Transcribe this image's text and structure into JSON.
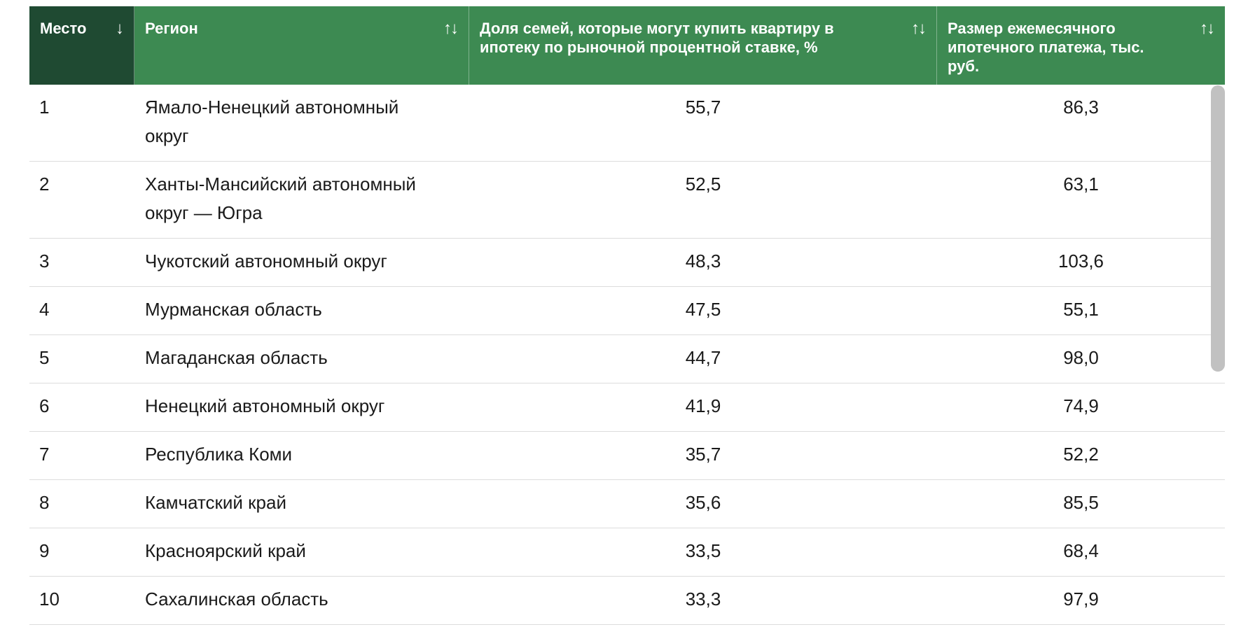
{
  "table": {
    "headers": {
      "place": "Место",
      "place_sort_icon": "↓",
      "region": "Регион",
      "region_sort_icon": "↑↓",
      "share": "Доля семей, которые могут купить квартиру в ипотеку по рыночной процентной ставке, %",
      "share_sort_icon": "↑↓",
      "payment": "Размер ежемесячного ипотечного платежа, тыс. руб.",
      "payment_sort_icon": "↑↓"
    },
    "rows": [
      {
        "place": "1",
        "region": "Ямало-Ненецкий автономный округ",
        "share": "55,7",
        "payment": "86,3"
      },
      {
        "place": "2",
        "region": "Ханты-Мансийский автономный округ — Югра",
        "share": "52,5",
        "payment": "63,1"
      },
      {
        "place": "3",
        "region": "Чукотский автономный округ",
        "share": "48,3",
        "payment": "103,6"
      },
      {
        "place": "4",
        "region": "Мурманская область",
        "share": "47,5",
        "payment": "55,1"
      },
      {
        "place": "5",
        "region": "Магаданская область",
        "share": "44,7",
        "payment": "98,0"
      },
      {
        "place": "6",
        "region": "Ненецкий автономный округ",
        "share": "41,9",
        "payment": "74,9"
      },
      {
        "place": "7",
        "region": "Республика Коми",
        "share": "35,7",
        "payment": "52,2"
      },
      {
        "place": "8",
        "region": "Камчатский край",
        "share": "35,6",
        "payment": "85,5"
      },
      {
        "place": "9",
        "region": "Красноярский край",
        "share": "33,5",
        "payment": "68,4"
      },
      {
        "place": "10",
        "region": "Сахалинская область",
        "share": "33,3",
        "payment": "97,9"
      }
    ]
  },
  "colors": {
    "header_bg": "#3d8a52",
    "header_active_bg": "#1f4a32",
    "header_text": "#ffffff",
    "row_divider": "#dcdcdc",
    "scrollbar": "#c1c1c1"
  },
  "icons": {
    "sort_active": "arrow-down-icon",
    "sort_neutral": "sort-up-down-icon"
  }
}
